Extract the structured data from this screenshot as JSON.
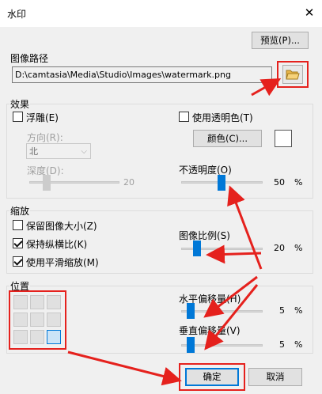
{
  "window": {
    "title": "水印",
    "close_glyph": "✕"
  },
  "buttons": {
    "preview": "预览(P)...",
    "color": "颜色(C)...",
    "ok": "确定",
    "cancel": "取消"
  },
  "image_path": {
    "label": "图像路径",
    "value": "D:\\camtasia\\Media\\Studio\\Images\\watermark.png"
  },
  "effects": {
    "label": "效果",
    "emboss": {
      "label": "浮雕(E)",
      "checked": false
    },
    "direction": {
      "label": "方向(R):",
      "value": "北"
    },
    "depth": {
      "label": "深度(D):",
      "value": "20"
    },
    "transparent_color": {
      "label": "使用透明色(T)",
      "checked": false
    },
    "opacity": {
      "label": "不透明度(O)",
      "value": "50",
      "unit": "%",
      "fraction": 0.5
    }
  },
  "scale": {
    "label": "缩放",
    "keep_size": {
      "label": "保留图像大小(Z)",
      "checked": false
    },
    "keep_aspect": {
      "label": "保持纵横比(K)",
      "checked": true
    },
    "smooth": {
      "label": "使用平滑缩放(M)",
      "checked": true
    },
    "image_scale": {
      "label": "图像比例(S)",
      "value": "20",
      "unit": "%",
      "fraction": 0.2
    }
  },
  "position": {
    "label": "位置",
    "grid_selected": 8,
    "h_offset": {
      "label": "水平偏移量(H)",
      "value": "5",
      "unit": "%",
      "fraction": 0.05
    },
    "v_offset": {
      "label": "垂直偏移量(V)",
      "value": "5",
      "unit": "%",
      "fraction": 0.05
    }
  },
  "colors": {
    "accent": "#0078d7",
    "highlight": "#e5211d"
  }
}
